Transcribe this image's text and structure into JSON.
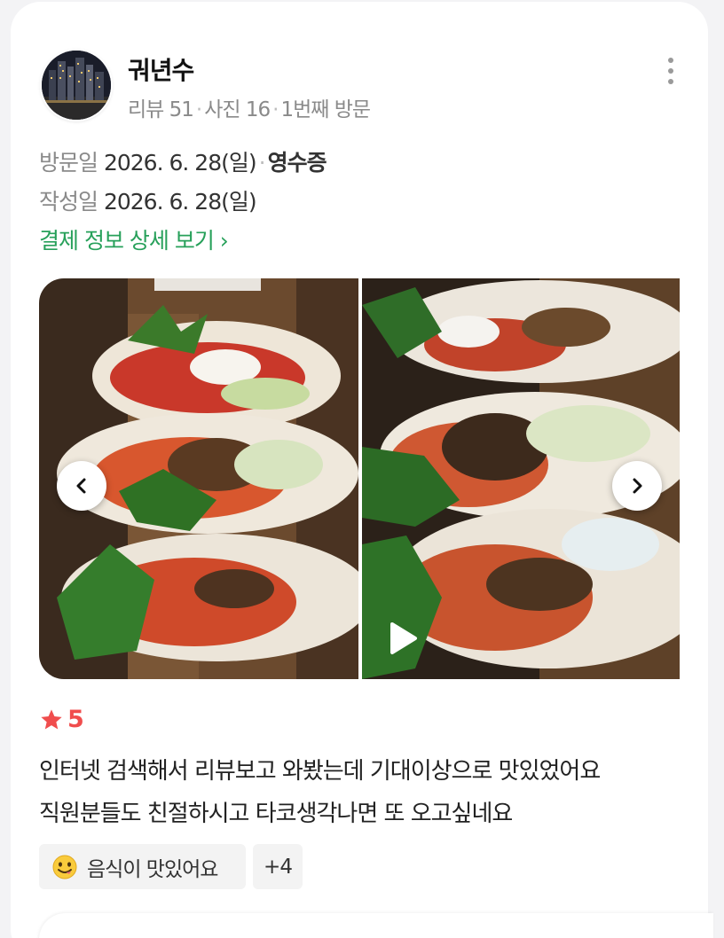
{
  "review": {
    "author": {
      "name": "궈년수",
      "reviews": "리뷰 51",
      "photos": "사진 16",
      "visit_count": "1번째 방문"
    },
    "visit": {
      "label": "방문일",
      "date": "2026. 6. 28(일)",
      "receipt": "영수증"
    },
    "written": {
      "label": "작성일",
      "date": "2026. 6. 28(일)"
    },
    "payment_link": "결제 정보 상세 보기",
    "rating": "5",
    "text_line1": "인터넷 검색해서 리뷰보고 와봤는데 기대이상으로 맛있었어요",
    "text_line2": "직원분들도 친절하시고 타코생각나면 또 오고싶네요",
    "keyword_chip": "음식이 맛있어요",
    "more_keywords": "+4"
  },
  "icons": {
    "more": "more-vertical-icon",
    "prev": "chevron-left-icon",
    "next": "chevron-right-icon",
    "star": "star-icon",
    "video": "play-icon",
    "emoji": "yummy-emoji-icon"
  },
  "colors": {
    "accent_green": "#27a05a",
    "star_red": "#f04d4d",
    "muted_text": "#8a8a8a"
  }
}
